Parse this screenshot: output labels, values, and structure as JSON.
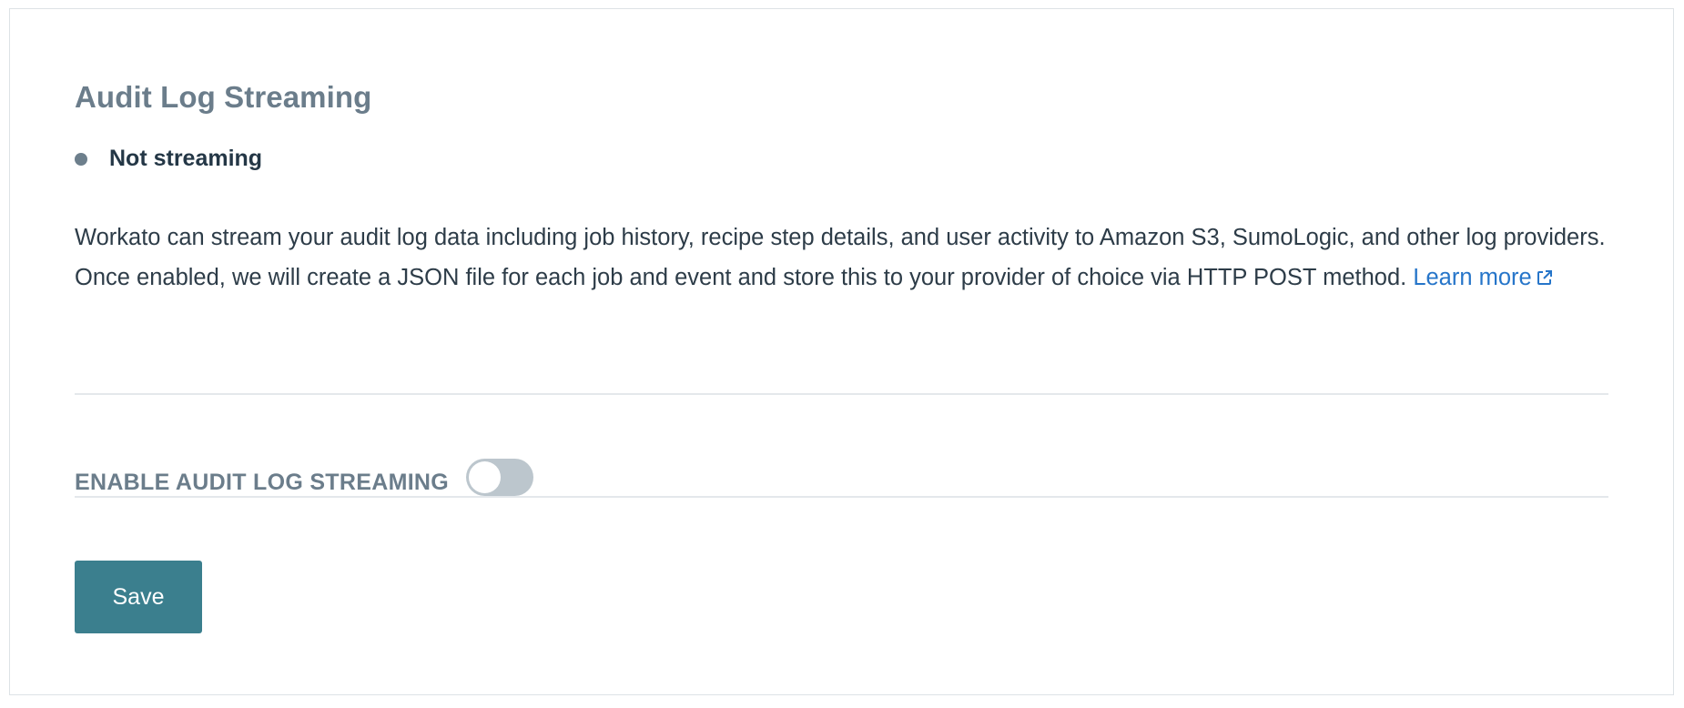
{
  "section": {
    "title": "Audit Log Streaming",
    "status": {
      "label": "Not streaming",
      "dot_color": "#6d7f8c"
    },
    "description": "Workato can stream your audit log data including job history, recipe step details, and user activity to Amazon S3, SumoLogic, and other log providers. Once enabled, we will create a JSON file for each job and event and store this to your provider of choice via HTTP POST method.",
    "learn_more": {
      "label": "Learn more",
      "icon": "external-link-icon",
      "color": "#2675c9"
    }
  },
  "toggle": {
    "label": "ENABLE AUDIT LOG STREAMING",
    "enabled": false
  },
  "actions": {
    "save_label": "Save",
    "save_color": "#3b7f8e"
  }
}
